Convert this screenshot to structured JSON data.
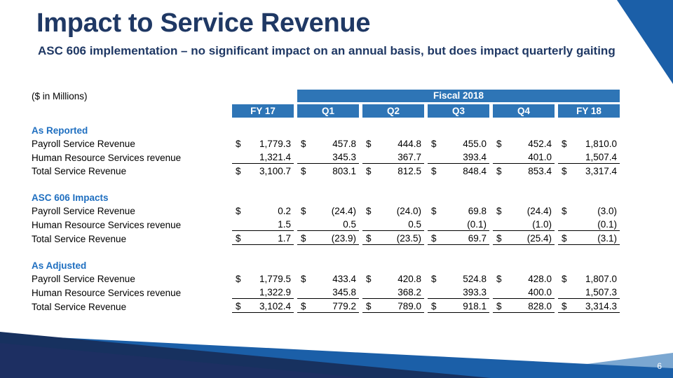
{
  "slide": {
    "title": "Impact to Service Revenue",
    "subtitle": "ASC 606 implementation – no significant impact on an annual basis, but does impact quarterly gaiting",
    "units_note": "($ in Millions)",
    "page_number": "6"
  },
  "colors": {
    "title_navy": "#1F3864",
    "header_blue": "#2E75B6",
    "section_blue": "#1F6FC0",
    "deco_navy": "#17315F",
    "deco_mid_blue": "#1B5FA8",
    "deco_light_blue": "#7BA7D1",
    "page_number_text": "#FFFFFF"
  },
  "table": {
    "group_header": {
      "label": "Fiscal 2018",
      "spans": [
        "Q1",
        "Q2",
        "Q3",
        "Q4",
        "FY 18"
      ]
    },
    "columns": [
      "FY 17",
      "Q1",
      "Q2",
      "Q3",
      "Q4",
      "FY 18"
    ],
    "row_label_header": "",
    "sections": [
      {
        "title": "As Reported",
        "rows": [
          {
            "label": "Payroll Service Revenue",
            "symbols": [
              "$",
              "$",
              "$",
              "$",
              "$",
              "$"
            ],
            "values": [
              "1,779.3",
              "457.8",
              "444.8",
              "455.0",
              "452.4",
              "1,810.0"
            ],
            "rule": "none"
          },
          {
            "label": "Human Resource Services revenue",
            "symbols": [
              "",
              "",
              "",
              "",
              "",
              ""
            ],
            "values": [
              "1,321.4",
              "345.3",
              "367.7",
              "393.4",
              "401.0",
              "1,507.4"
            ],
            "rule": "none"
          },
          {
            "label": "Total Service Revenue",
            "symbols": [
              "$",
              "$",
              "$",
              "$",
              "$",
              "$"
            ],
            "values": [
              "3,100.7",
              "803.1",
              "812.5",
              "848.4",
              "853.4",
              "3,317.4"
            ],
            "rule": "top"
          }
        ]
      },
      {
        "title": "ASC 606 Impacts",
        "rows": [
          {
            "label": "Payroll Service Revenue",
            "symbols": [
              "$",
              "$",
              "$",
              "$",
              "$",
              "$"
            ],
            "values": [
              "0.2",
              "(24.4)",
              "(24.0)",
              "69.8",
              "(24.4)",
              "(3.0)"
            ],
            "rule": "none"
          },
          {
            "label": "Human Resource Services revenue",
            "symbols": [
              "",
              "",
              "",
              "",
              "",
              ""
            ],
            "values": [
              "1.5",
              "0.5",
              "0.5",
              "(0.1)",
              "(1.0)",
              "(0.1)"
            ],
            "rule": "none"
          },
          {
            "label": "Total Service Revenue",
            "symbols": [
              "$",
              "$",
              "$",
              "$",
              "$",
              "$"
            ],
            "values": [
              "1.7",
              "(23.9)",
              "(23.5)",
              "69.7",
              "(25.4)",
              "(3.1)"
            ],
            "rule": "top-bottom"
          }
        ]
      },
      {
        "title": "As Adjusted",
        "rows": [
          {
            "label": "Payroll Service Revenue",
            "symbols": [
              "$",
              "$",
              "$",
              "$",
              "$",
              "$"
            ],
            "values": [
              "1,779.5",
              "433.4",
              "420.8",
              "524.8",
              "428.0",
              "1,807.0"
            ],
            "rule": "none"
          },
          {
            "label": "Human Resource Services revenue",
            "symbols": [
              "",
              "",
              "",
              "",
              "",
              ""
            ],
            "values": [
              "1,322.9",
              "345.8",
              "368.2",
              "393.3",
              "400.0",
              "1,507.3"
            ],
            "rule": "none"
          },
          {
            "label": "Total Service Revenue",
            "symbols": [
              "$",
              "$",
              "$",
              "$",
              "$",
              "$"
            ],
            "values": [
              "3,102.4",
              "779.2",
              "789.0",
              "918.1",
              "828.0",
              "3,314.3"
            ],
            "rule": "top-bottom"
          }
        ]
      }
    ]
  }
}
